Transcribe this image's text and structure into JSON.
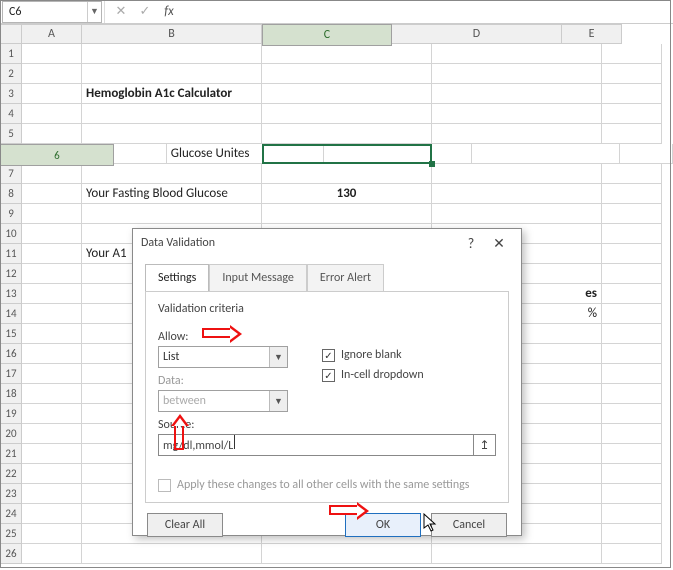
{
  "namebox": {
    "value": "C6"
  },
  "fx": {
    "cancel_glyph": "✕",
    "enter_glyph": "✓",
    "fx_label": "fx"
  },
  "columns": [
    "A",
    "B",
    "C",
    "D",
    "E"
  ],
  "rows_count": 26,
  "active_col": "C",
  "active_row": 6,
  "cells": {
    "B3": "Hemoglobin A1c Calculator",
    "B6": "Glucose Unites",
    "B8": "Your Fasting Blood Glucose",
    "C8": "130",
    "B11": "Your A1",
    "D13_tail": "es",
    "D14_tail": "%"
  },
  "dialog": {
    "title": "Data Validation",
    "help_glyph": "?",
    "close_glyph": "✕",
    "tabs": [
      "Settings",
      "Input Message",
      "Error Alert"
    ],
    "active_tab": 0,
    "criteria_label": "Validation criteria",
    "allow_label": "Allow:",
    "allow_value": "List",
    "data_label": "Data:",
    "data_value": "between",
    "source_label": "Source:",
    "source_value": "mg/dl,mmol/L",
    "ignore_blank_label": "Ignore blank",
    "ignore_blank_checked": true,
    "incell_label": "In-cell dropdown",
    "incell_checked": true,
    "apply_label": "Apply these changes to all other cells with the same settings",
    "apply_checked": false,
    "clear_all": "Clear All",
    "ok": "OK",
    "cancel": "Cancel",
    "src_picker_glyph": "↥"
  }
}
